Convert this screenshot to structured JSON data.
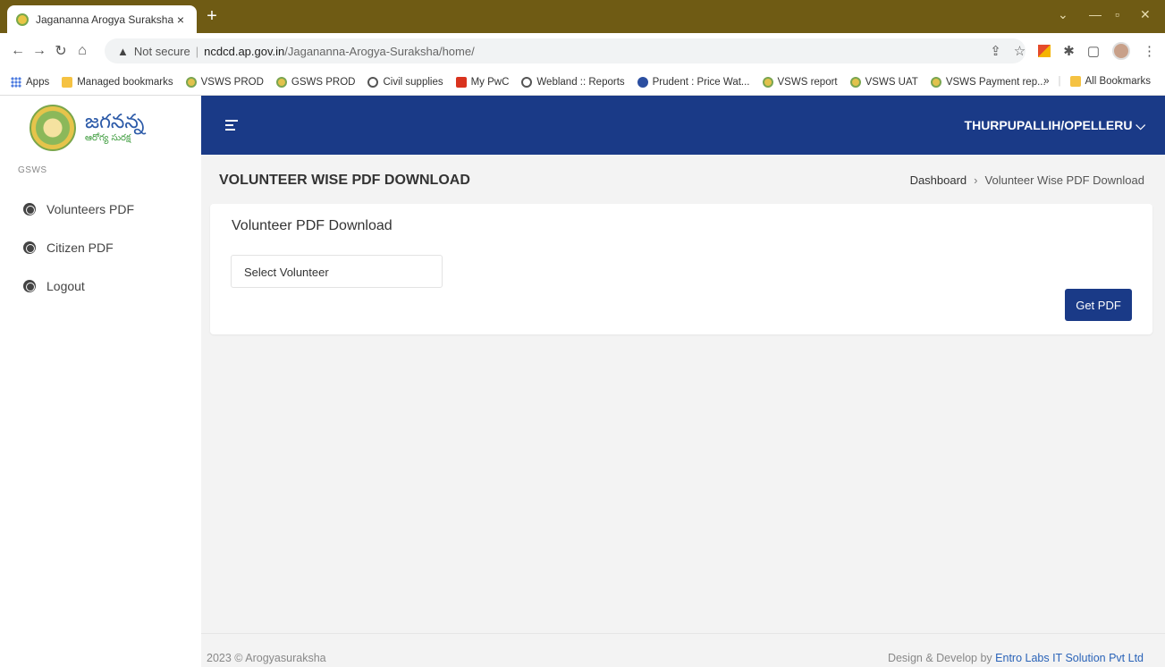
{
  "browser": {
    "tab_title": "Jagananna Arogya Suraksha",
    "tab_close": "×",
    "new_tab": "+",
    "address": {
      "security": "Not secure",
      "host": "ncdcd.ap.gov.in",
      "path": "/Jagananna-Arogya-Suraksha/home/"
    },
    "bookmarks": [
      {
        "label": "Apps",
        "icon": "apps-grid-icon"
      },
      {
        "label": "Managed bookmarks",
        "icon": "folder-icon"
      },
      {
        "label": "VSWS PROD",
        "icon": "gsws-favicon"
      },
      {
        "label": "GSWS PROD",
        "icon": "gsws-favicon"
      },
      {
        "label": "Civil supplies",
        "icon": "globe-icon"
      },
      {
        "label": "My PwC",
        "icon": "pwc-favicon"
      },
      {
        "label": "Webland :: Reports",
        "icon": "globe-icon"
      },
      {
        "label": "Prudent : Price Wat...",
        "icon": "prudent-favicon"
      },
      {
        "label": "VSWS report",
        "icon": "gsws-favicon"
      },
      {
        "label": "VSWS UAT",
        "icon": "gsws-favicon"
      },
      {
        "label": "VSWS Payment rep...",
        "icon": "gsws-favicon"
      }
    ],
    "more_bookmarks": "»",
    "all_bookmarks": "All Bookmarks"
  },
  "sidebar": {
    "logo_text": "జగనన్న",
    "logo_subtext": "ఆరోగ్య సురక్ష",
    "section": "GSWS",
    "items": [
      {
        "label": "Volunteers PDF",
        "icon": "globe-icon"
      },
      {
        "label": "Citizen PDF",
        "icon": "globe-icon"
      },
      {
        "label": "Logout",
        "icon": "globe-icon"
      }
    ]
  },
  "header": {
    "user_location": "THURPUPALLIH/OPELLERU ⌵"
  },
  "page": {
    "title": "VOLUNTEER WISE PDF DOWNLOAD",
    "breadcrumb": {
      "home": "Dashboard",
      "separator": "›",
      "current": "Volunteer Wise PDF Download"
    }
  },
  "card": {
    "title": "Volunteer PDF Download",
    "select_value": "Select Volunteer",
    "button": "Get PDF"
  },
  "footer": {
    "copyright": "2023 © Arogyasuraksha",
    "credit_prefix": "Design & Develop by ",
    "credit_company": "Entro Labs IT Solution Pvt Ltd"
  },
  "colors": {
    "tab_strip": "#6f5b14",
    "header": "#1a3a87",
    "button": "#1a3a87",
    "link": "#2a63b8"
  }
}
